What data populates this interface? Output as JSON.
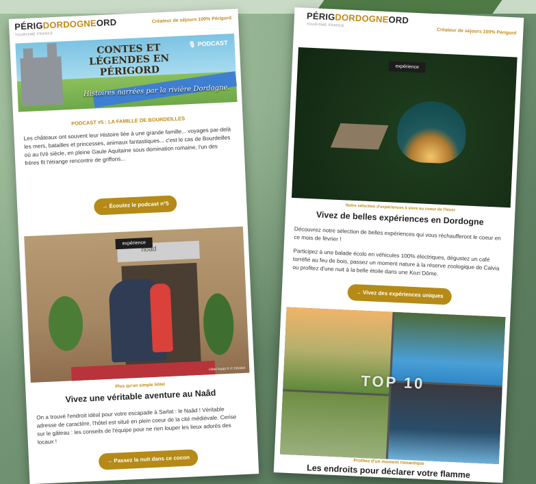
{
  "left": {
    "logo": {
      "line1a": "PÉRIG",
      "line1b": "DORDOGNE",
      "line1c": "ORD",
      "line2": "TOURISME FRANCE"
    },
    "tagline": "Créateur de séjours 100% Périgord",
    "banner": {
      "title": "CONTES ET LÉGENDES EN PÉRIGORD",
      "podcast": "🎙 PODCAST",
      "subtitle": "Histoires narrées par la rivière Dordogne."
    },
    "kicker": "PODCAST #5 : LA FAMILLE DE BOURDEILLES",
    "para1": "Les châteaux ont souvent leur Histoire liée à une grande famille... voyages par-delà les mers, batailles et princesses, animaux fantastiques... c'est le cas de Bourdeilles où au IVè siècle, en pleine Gaule Aquitaine sous domination romaine, l'un des frères fit l'étrange rencontre de griffons...",
    "cta1": "→ Écoutez le podcast n°5",
    "photo_badge": "expérience",
    "hotel_sign": "noâd",
    "photo_credit": "Hôtel Naâd © © Décibel",
    "small_kicker": "Plus qu'un simple hôtel",
    "title2": "Vivez une véritable aventure au Naâd",
    "para2": "On a trouvé l'endroit idéal pour votre escapade à Sarlat : le Naâd ! Véritable adresse de caractère, l'hôtel est situé en plein coeur de la cité médiévale. Cerise sur le gâteau : les conseils de l'équipe pour ne rien louper les lieux adorés des locaux !",
    "cta2": "→ Passez la nuit dans ce cocon"
  },
  "right": {
    "logo": {
      "line1a": "PÉRIG",
      "line1b": "DORDOGNE",
      "line1c": "ORD",
      "line2": "TOURISME FRANCE"
    },
    "tagline": "Créateur de séjours 100% Périgord",
    "photo_badge": "expérience",
    "small_kicker": "Notre sélection d'expériences à vivre au coeur de l'hiver",
    "title1": "Vivez de belles expériences en Dordogne",
    "para1": "Découvrez notre sélection de belles expériences qui vous réchaufferont le coeur en ce mois de février !",
    "para2": "Participez à une balade écolo en véhicules 100% électriques, dégustez un café torréfié au feu de bois, passez un moment nature à la réserve zoologique de Calvia ou profitez d'une nuit à la belle étoile dans une Kozi Dôme.",
    "cta1": "→ Vivez des expériences uniques",
    "collage_text": "TOP 10",
    "small_kicker2": "Profitez d'un moment romantique",
    "title2": "Les endroits pour déclarer votre flamme"
  }
}
